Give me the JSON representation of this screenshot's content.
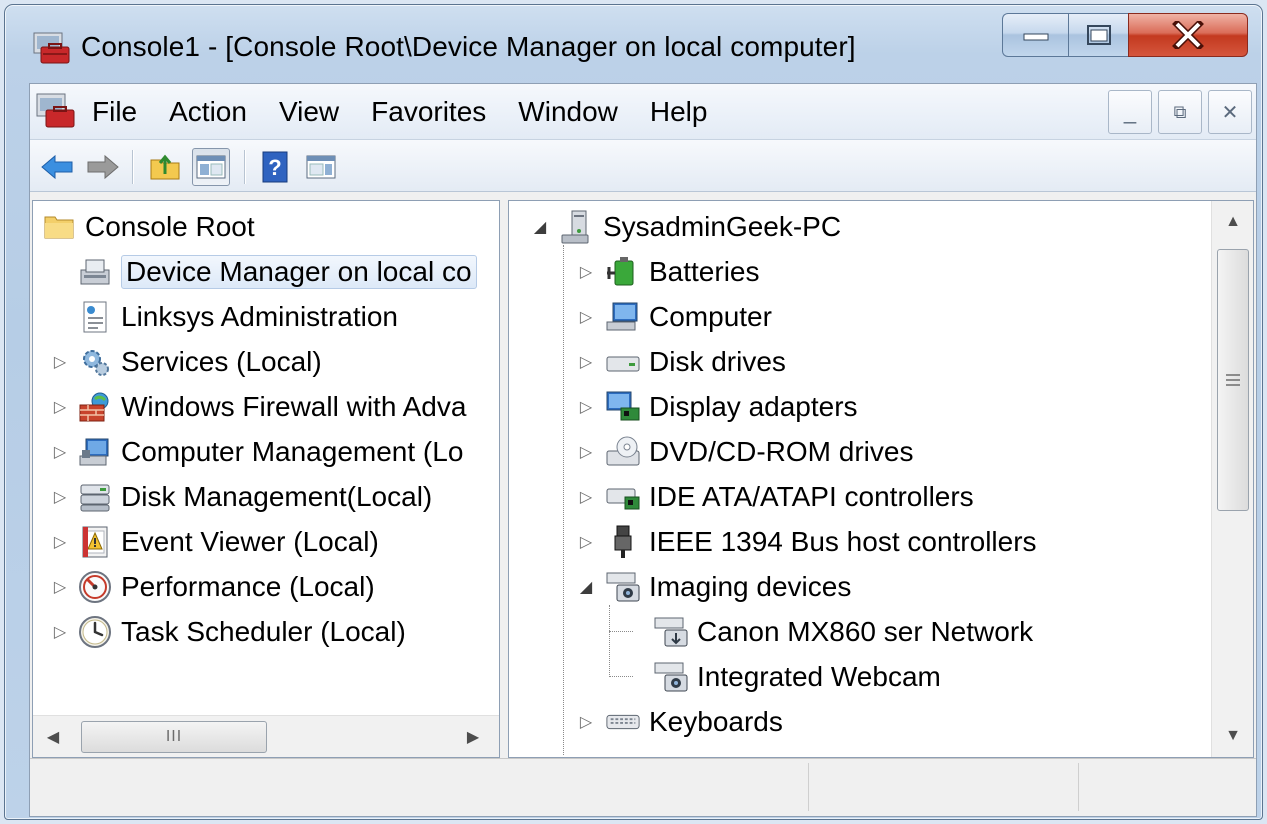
{
  "window": {
    "title": "Console1 - [Console Root\\Device Manager on local computer]"
  },
  "menu": [
    "File",
    "Action",
    "View",
    "Favorites",
    "Window",
    "Help"
  ],
  "mdi_buttons": [
    "_",
    "⧉",
    "✕"
  ],
  "toolbar": [
    "back",
    "forward",
    "up-folder",
    "show-hide-console-tree",
    "help",
    "show-hide-action-pane"
  ],
  "left_tree": {
    "root": "Console Root",
    "items": [
      {
        "label": "Device Manager on local co",
        "icon": "device-manager-icon",
        "selected": true,
        "expandable": false
      },
      {
        "label": "Linksys Administration",
        "icon": "web-page-icon",
        "expandable": false
      },
      {
        "label": "Services (Local)",
        "icon": "services-gear-icon",
        "expandable": true
      },
      {
        "label": "Windows Firewall with Adva",
        "icon": "firewall-icon",
        "expandable": true
      },
      {
        "label": "Computer Management (Lo",
        "icon": "computer-management-icon",
        "expandable": true
      },
      {
        "label": "Disk Management(Local)",
        "icon": "disk-management-icon",
        "expandable": true
      },
      {
        "label": "Event Viewer (Local)",
        "icon": "event-viewer-icon",
        "expandable": true
      },
      {
        "label": "Performance (Local)",
        "icon": "performance-icon",
        "expandable": true
      },
      {
        "label": "Task Scheduler (Local)",
        "icon": "task-scheduler-icon",
        "expandable": true
      }
    ],
    "hscroll_thumb": "III"
  },
  "right_tree": {
    "root": "SysadminGeek-PC",
    "items": [
      {
        "label": "Batteries",
        "icon": "battery-icon",
        "level": 1,
        "state": "collapsed"
      },
      {
        "label": "Computer",
        "icon": "computer-icon",
        "level": 1,
        "state": "collapsed"
      },
      {
        "label": "Disk drives",
        "icon": "disk-drive-icon",
        "level": 1,
        "state": "collapsed"
      },
      {
        "label": "Display adapters",
        "icon": "display-adapter-icon",
        "level": 1,
        "state": "collapsed"
      },
      {
        "label": "DVD/CD-ROM drives",
        "icon": "dvd-drive-icon",
        "level": 1,
        "state": "collapsed"
      },
      {
        "label": "IDE ATA/ATAPI controllers",
        "icon": "ide-controller-icon",
        "level": 1,
        "state": "collapsed"
      },
      {
        "label": "IEEE 1394 Bus host controllers",
        "icon": "firewire-icon",
        "level": 1,
        "state": "collapsed"
      },
      {
        "label": "Imaging devices",
        "icon": "imaging-device-icon",
        "level": 1,
        "state": "expanded"
      },
      {
        "label": "Canon MX860 ser Network",
        "icon": "scanner-icon",
        "level": 2,
        "state": "leaf"
      },
      {
        "label": "Integrated Webcam",
        "icon": "webcam-icon",
        "level": 2,
        "state": "leaf"
      },
      {
        "label": "Keyboards",
        "icon": "keyboard-icon",
        "level": 1,
        "state": "collapsed"
      }
    ]
  }
}
